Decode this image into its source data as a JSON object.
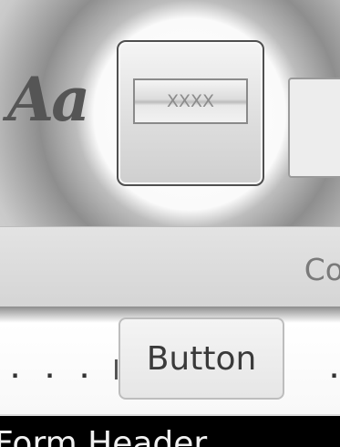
{
  "ribbon": {
    "aa_glyph": "Aa",
    "theme_swatch_label": "XXXX",
    "group_label_partial": "Co"
  },
  "toolbox": {
    "button_label": "Button"
  },
  "form": {
    "section_label_partial": "Form Header"
  }
}
